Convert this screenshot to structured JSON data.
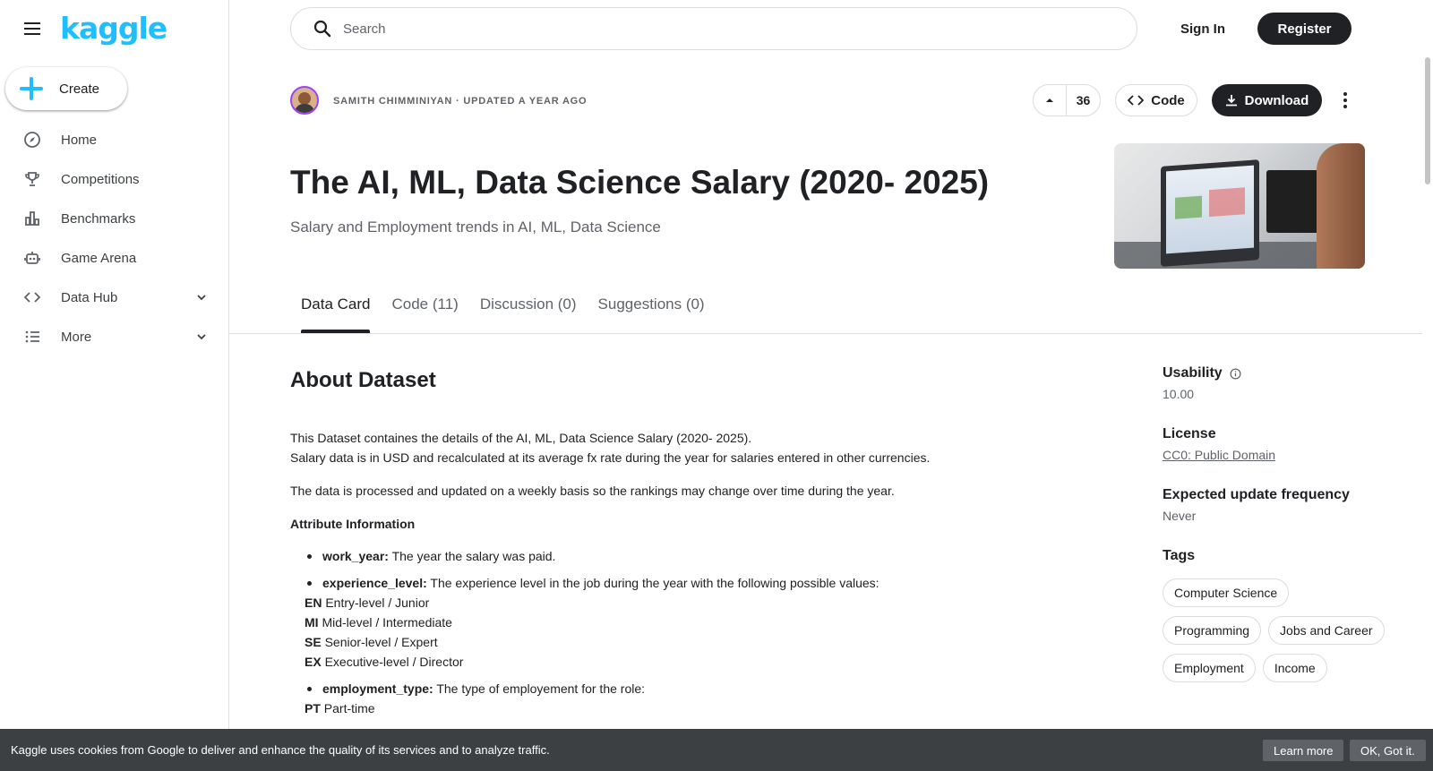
{
  "sidebar": {
    "logo": "kaggle",
    "create_label": "Create",
    "items": [
      {
        "label": "Home",
        "icon": "compass-icon"
      },
      {
        "label": "Competitions",
        "icon": "trophy-icon"
      },
      {
        "label": "Benchmarks",
        "icon": "bar-chart-icon"
      },
      {
        "label": "Game Arena",
        "icon": "robot-icon"
      },
      {
        "label": "Data Hub",
        "icon": "code-icon",
        "expandable": true
      },
      {
        "label": "More",
        "icon": "list-icon",
        "expandable": true
      }
    ]
  },
  "header": {
    "search_placeholder": "Search",
    "sign_in": "Sign In",
    "register": "Register"
  },
  "dataset": {
    "author_line": "SAMITH CHIMMINIYAN · UPDATED A YEAR AGO",
    "votes": "36",
    "code_label": "Code",
    "download_label": "Download",
    "title": "The AI, ML, Data Science Salary (2020- 2025)",
    "subtitle": "Salary and Employment trends in AI, ML, Data Science"
  },
  "tabs": [
    {
      "label": "Data Card",
      "active": true
    },
    {
      "label": "Code (11)"
    },
    {
      "label": "Discussion (0)"
    },
    {
      "label": "Suggestions (0)"
    }
  ],
  "about": {
    "heading": "About Dataset",
    "p1_line1": "This Dataset containes the details of the AI, ML, Data Science Salary (2020- 2025).",
    "p1_line2": "Salary data is in USD and recalculated at its average fx rate during the year for salaries entered in other currencies.",
    "p2": "The data is processed and updated on a weekly basis so the rankings may change over time during the year.",
    "attr_title": "Attribute Information",
    "attrs": [
      {
        "name": "work_year:",
        "desc": "The year the salary was paid."
      },
      {
        "name": "experience_level:",
        "desc": "The experience level in the job during the year with the following possible values:",
        "codes": [
          {
            "code": "EN",
            "text": "Entry-level / Junior"
          },
          {
            "code": "MI",
            "text": "Mid-level / Intermediate"
          },
          {
            "code": "SE",
            "text": "Senior-level / Expert"
          },
          {
            "code": "EX",
            "text": "Executive-level / Director"
          }
        ]
      },
      {
        "name": "employment_type:",
        "desc": "The type of employement for the role:",
        "codes": [
          {
            "code": "PT",
            "text": "Part-time"
          }
        ]
      }
    ]
  },
  "meta": {
    "usability_label": "Usability",
    "usability_value": "10.00",
    "license_label": "License",
    "license_value": "CC0: Public Domain",
    "frequency_label": "Expected update frequency",
    "frequency_value": "Never",
    "tags_label": "Tags",
    "tags": [
      "Computer Science",
      "Programming",
      "Jobs and Career",
      "Employment",
      "Income"
    ]
  },
  "cookie": {
    "text": "Kaggle uses cookies from Google to deliver and enhance the quality of its services and to analyze traffic.",
    "learn_more": "Learn more",
    "ok": "OK, Got it."
  },
  "colors": {
    "brand": "#20beff",
    "dark": "#202124",
    "muted": "#5f6368"
  }
}
